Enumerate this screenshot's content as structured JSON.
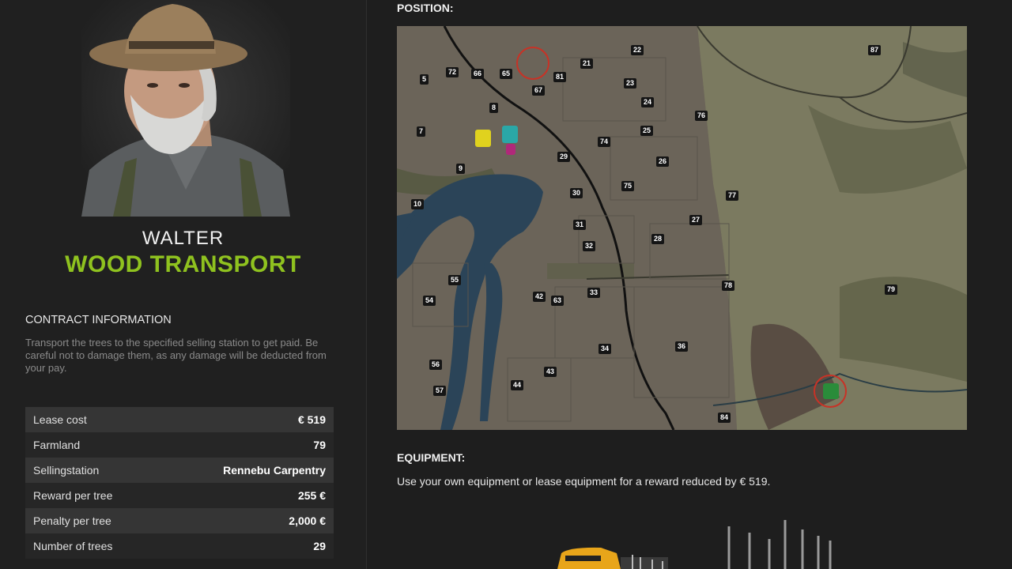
{
  "npc": {
    "name": "WALTER",
    "contract_type": "WOOD TRANSPORT"
  },
  "contract_info": {
    "heading": "CONTRACT INFORMATION",
    "description": "Transport the trees to the specified selling station to get paid. Be careful not to damage them, as any damage will be deducted from your pay."
  },
  "details": [
    {
      "label": "Lease cost",
      "value": "€ 519"
    },
    {
      "label": "Farmland",
      "value": "79"
    },
    {
      "label": "Sellingstation",
      "value": "Rennebu Carpentry"
    },
    {
      "label": "Reward per tree",
      "value": "255 €"
    },
    {
      "label": "Penalty per tree",
      "value": "2,000 €"
    },
    {
      "label": "Number of trees",
      "value": "29"
    }
  ],
  "position": {
    "heading": "POSITION:",
    "plots": [
      "5",
      "72",
      "66",
      "65",
      "67",
      "81",
      "21",
      "22",
      "87",
      "23",
      "8",
      "24",
      "76",
      "7",
      "25",
      "74",
      "29",
      "26",
      "9",
      "30",
      "75",
      "77",
      "10",
      "27",
      "31",
      "28",
      "32",
      "55",
      "78",
      "79",
      "54",
      "42",
      "63",
      "33",
      "36",
      "34",
      "56",
      "43",
      "57",
      "44",
      "84"
    ]
  },
  "equipment": {
    "heading": "EQUIPMENT:",
    "text": "Use your own equipment or lease equipment for a reward reduced by € 519."
  },
  "colors": {
    "accent": "#8fc21f",
    "marker_ring": "#c83226"
  }
}
